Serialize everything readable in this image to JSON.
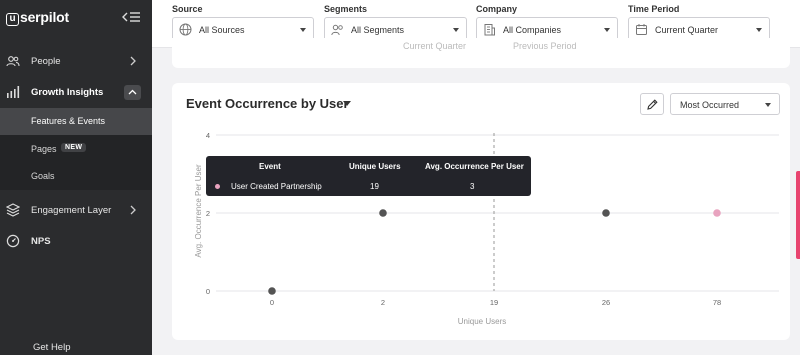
{
  "brand": {
    "logo_letter": "u",
    "logo_text": "serpilot"
  },
  "sidebar": {
    "items": [
      {
        "label": "People",
        "icon": "people-icon"
      },
      {
        "label": "Growth Insights",
        "icon": "chart-bars-icon"
      },
      {
        "label": "Engagement Layer",
        "icon": "layers-icon"
      },
      {
        "label": "NPS",
        "icon": "nps-gauge-icon"
      }
    ],
    "sub_items": [
      {
        "label": "Features & Events",
        "active": true
      },
      {
        "label": "Pages",
        "badge": "NEW"
      },
      {
        "label": "Goals"
      }
    ],
    "help_label": "Get Help"
  },
  "filters": [
    {
      "label": "Source",
      "value": "All Sources",
      "icon": "globe-icon"
    },
    {
      "label": "Segments",
      "value": "All Segments",
      "icon": "segments-icon"
    },
    {
      "label": "Company",
      "value": "All Companies",
      "icon": "building-icon"
    },
    {
      "label": "Time Period",
      "value": "Current Quarter",
      "icon": "calendar-icon"
    }
  ],
  "top_card": {
    "legend": [
      "Current Quarter",
      "Previous Period"
    ]
  },
  "card": {
    "title": "Event Occurrence by User",
    "sort_value": "Most Occurred",
    "edit_icon": "pencil-icon"
  },
  "tooltip": {
    "headers": [
      "Event",
      "Unique Users",
      "Avg. Occurrence Per User"
    ],
    "row": {
      "event": "User Created Partnership",
      "unique_users": "19",
      "avg": "3"
    },
    "dot_color": "#e8a3bf"
  },
  "colors": {
    "sidebar_bg": "#2b2c2e",
    "accent_pink": "#e8446f",
    "point_dark": "#545454",
    "point_pink": "#e8a3bf"
  },
  "chart_data": {
    "type": "scatter",
    "xlabel": "Unique Users",
    "ylabel": "Avg. Occurrence Per User",
    "x_categories": [
      "0",
      "2",
      "19",
      "26",
      "78"
    ],
    "y_ticks": [
      0,
      2,
      4
    ],
    "ylim": [
      0,
      4
    ],
    "highlight_category": "19",
    "points": [
      {
        "x": "0",
        "y": 0,
        "color": "#545454"
      },
      {
        "x": "2",
        "y": 2,
        "color": "#545454"
      },
      {
        "x": "26",
        "y": 2,
        "color": "#545454"
      },
      {
        "x": "78",
        "y": 2,
        "color": "#e8a3bf"
      }
    ],
    "grid": true
  }
}
